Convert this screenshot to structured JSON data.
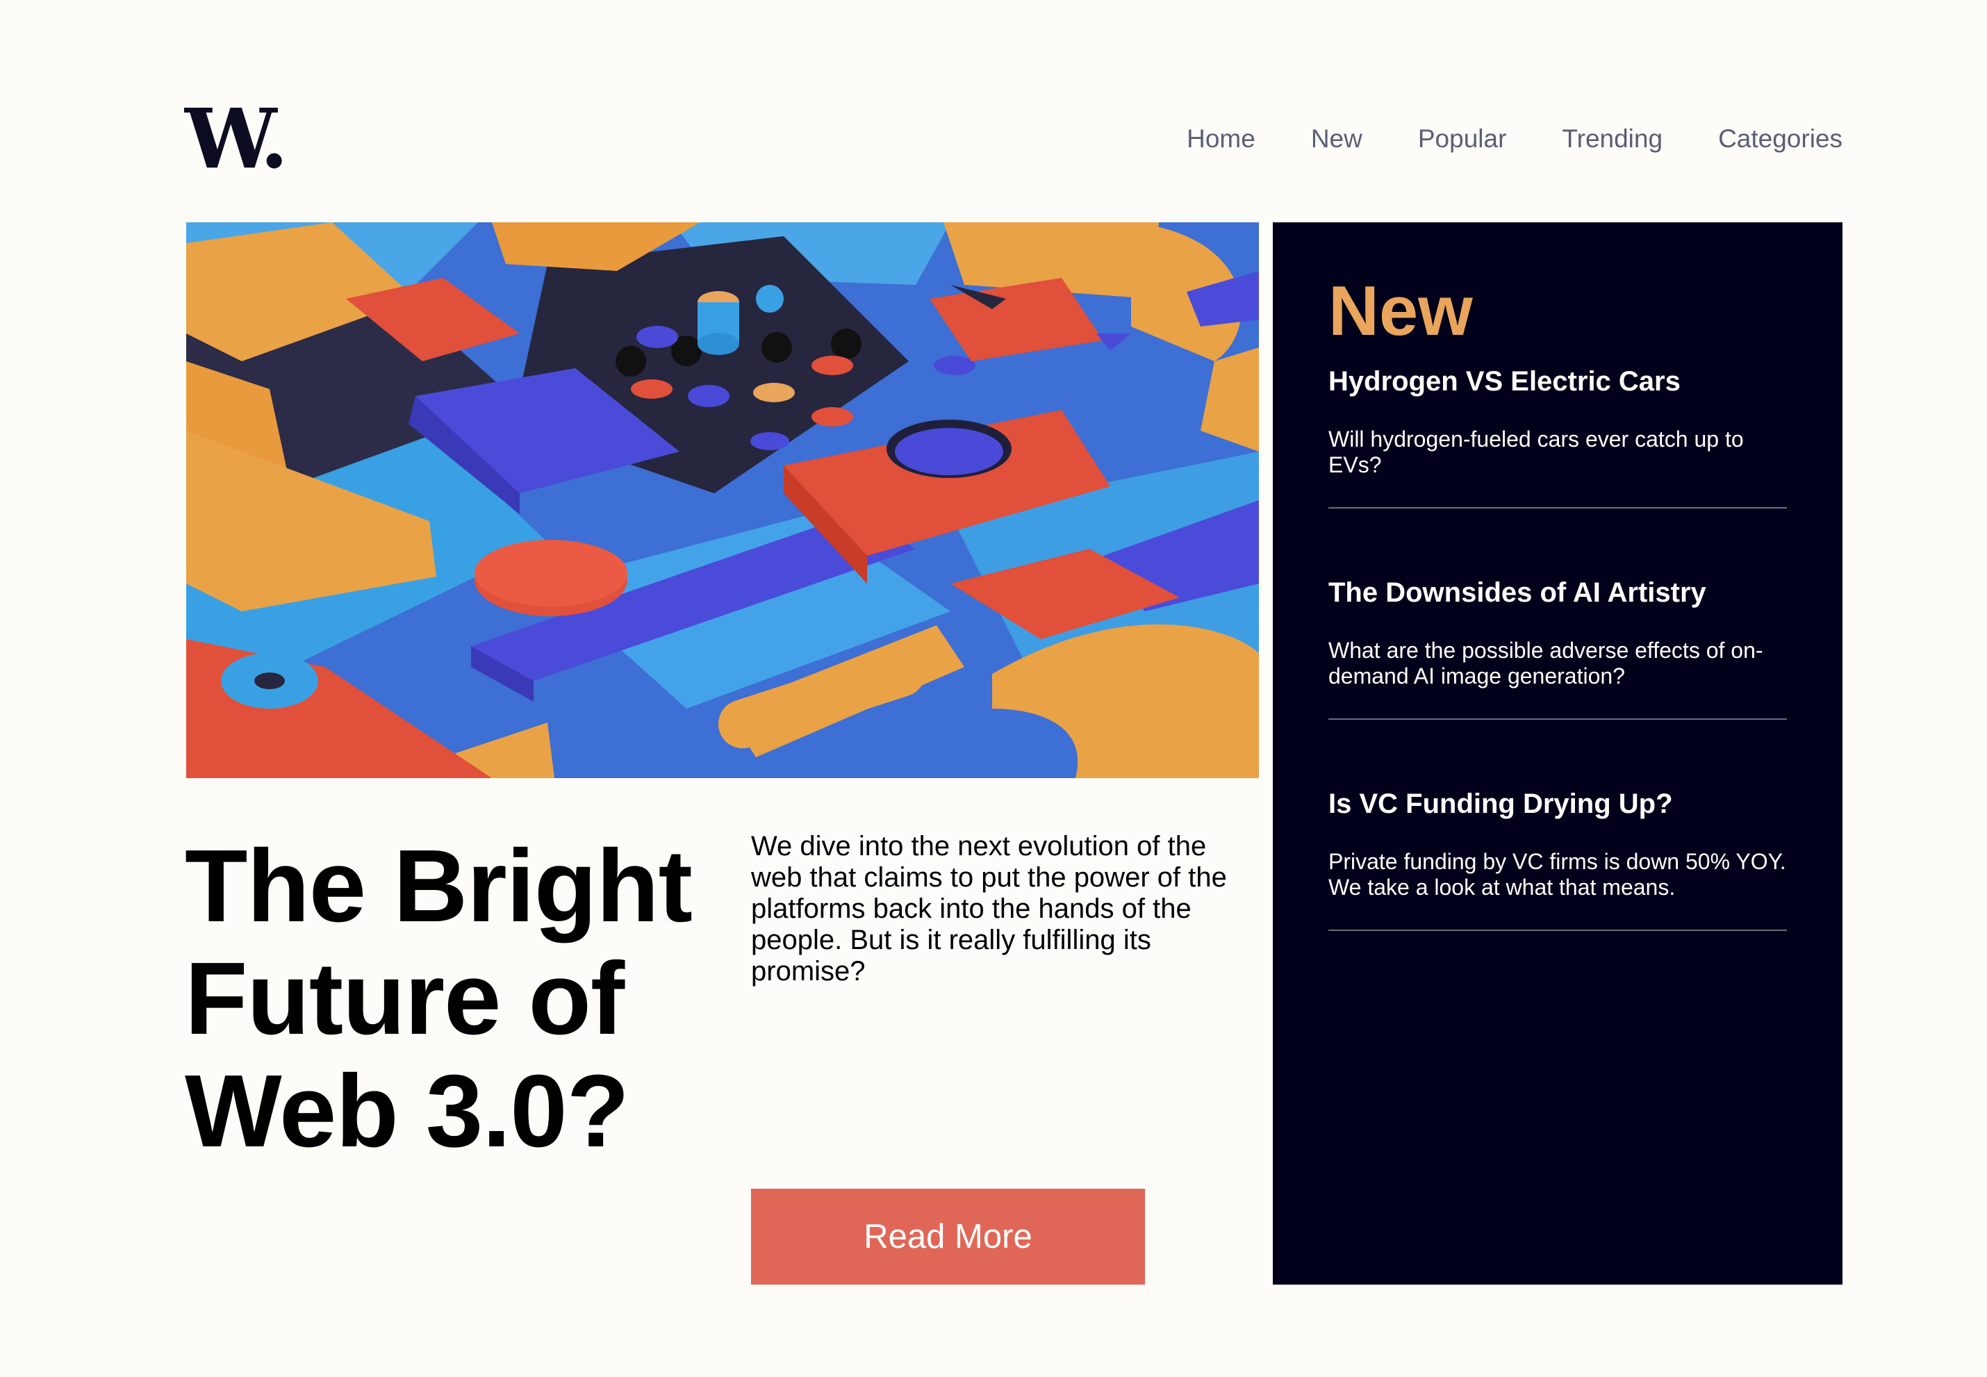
{
  "brand": {
    "logo_text": "W."
  },
  "nav": {
    "items": [
      "Home",
      "New",
      "Popular",
      "Trending",
      "Categories"
    ]
  },
  "hero": {
    "image_name": "abstract colorful 3D shapes illustration",
    "title": "The Bright Future of Web 3.0?",
    "description": "We dive into the next evolution of the web that claims to put the power of the platforms back into the hands of the people. But is it really fulfilling its promise?",
    "button_label": "Read More"
  },
  "sidebar": {
    "heading": "New",
    "articles": [
      {
        "title": "Hydrogen VS Electric Cars",
        "summary": "Will hydrogen-fueled cars ever catch up to EVs?"
      },
      {
        "title": "The Downsides of AI Artistry",
        "summary": "What are the possible adverse effects of on-demand AI image generation?"
      },
      {
        "title": "Is VC Funding Drying Up?",
        "summary": "Private funding by VC firms is down 50% YOY. We take a look at what that means."
      }
    ]
  },
  "colors": {
    "background": "#fdfcf8",
    "sidebar_bg": "#00001a",
    "accent_orange": "#e9a55c",
    "button_red": "#e06757",
    "nav_text": "#5b5e75"
  }
}
